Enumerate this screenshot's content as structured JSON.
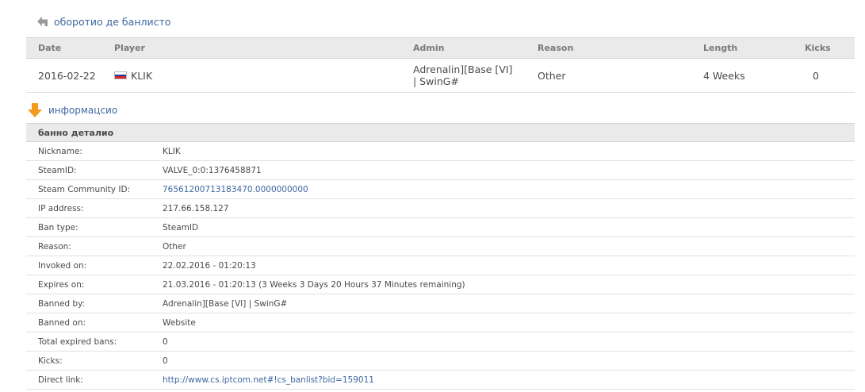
{
  "back_link": {
    "label": "оборотио де банлисто"
  },
  "ban_list": {
    "headers": {
      "date": "Date",
      "player": "Player",
      "admin": "Admin",
      "reason": "Reason",
      "length": "Length",
      "kicks": "Kicks"
    },
    "rows": [
      {
        "date": "2016-02-22",
        "player": "KLIK",
        "flag_colors": [
          "#ffffff",
          "#1d3fa8",
          "#d8262d"
        ],
        "admin_line1": "Adrenalin][Base [VI]",
        "admin_line2": "| SwinG#",
        "reason": "Other",
        "length": "4 Weeks",
        "kicks": "0"
      }
    ]
  },
  "info_section": {
    "label": "информацсио"
  },
  "details": {
    "title": "банно деталио",
    "rows": [
      {
        "label": "Nickname:",
        "value": "KLIK",
        "link": false
      },
      {
        "label": "SteamID:",
        "value": "VALVE_0:0:1376458871",
        "link": false
      },
      {
        "label": "Steam Community ID:",
        "value": "76561200713183470.0000000000",
        "link": true
      },
      {
        "label": "IP address:",
        "value": "217.66.158.127",
        "link": false
      },
      {
        "label": "Ban type:",
        "value": "SteamID",
        "link": false
      },
      {
        "label": "Reason:",
        "value": "Other",
        "link": false
      },
      {
        "label": "Invoked on:",
        "value": "22.02.2016 - 01:20:13",
        "link": false
      },
      {
        "label": "Expires on:",
        "value": "21.03.2016 - 01:20:13 (3 Weeks 3 Days 20 Hours 37 Minutes remaining)",
        "link": false
      },
      {
        "label": "Banned by:",
        "value": "Adrenalin][Base [VI] | SwinG#",
        "link": false
      },
      {
        "label": "Banned on:",
        "value": "Website",
        "link": false
      },
      {
        "label": "Total expired bans:",
        "value": "0",
        "link": false
      },
      {
        "label": "Kicks:",
        "value": "0",
        "link": false
      },
      {
        "label": "Direct link:",
        "value": "http://www.cs.iptcom.net#!cs_banlist?bid=159011",
        "link": true
      }
    ]
  },
  "colors": {
    "link": "#3d67a0",
    "header_bg": "#eaeaea",
    "arrow_orange": "#f39a1e",
    "arrow_gray": "#9a9a9a"
  }
}
